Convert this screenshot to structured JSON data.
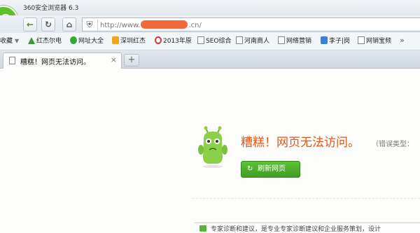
{
  "window": {
    "title": "360安全浏览器 6.3"
  },
  "toolbar": {
    "back_icon": "arrow-left-icon",
    "refresh_icon": "refresh-icon",
    "home_icon": "home-icon",
    "security_icon": "shield-icon",
    "address": {
      "prefix": "http://www.",
      "suffix": ".cn/"
    }
  },
  "bookmarks": {
    "items": [
      {
        "label": "收藏",
        "icon": "none"
      },
      {
        "label": "红杰尔电",
        "icon": "green-triangle-icon"
      },
      {
        "label": "网址大全",
        "icon": "green-circle-icon"
      },
      {
        "label": "深圳红杰",
        "icon": "orange-flag-icon"
      },
      {
        "label": "2013年原",
        "icon": "red-clock-icon"
      },
      {
        "label": "SEO综合",
        "icon": "page-icon"
      },
      {
        "label": "河南商人",
        "icon": "page-icon"
      },
      {
        "label": "网络营销",
        "icon": "page-icon"
      },
      {
        "label": "李子|岗",
        "icon": "blue-s-icon"
      },
      {
        "label": "网销宝频",
        "icon": "page-icon"
      }
    ],
    "more": "»"
  },
  "tabs": [
    {
      "label": "糟糕！网页无法访问。",
      "close": "×",
      "active": true
    }
  ],
  "new_tab": "+",
  "error": {
    "title": "糟糕！网页无法访问。",
    "type_label": "（错误类型：",
    "refresh_button": "刷新网页"
  },
  "bottom": {
    "text": "专家诊断和建议，是专业专家诊断建议和企业服务策划，设计"
  },
  "colors": {
    "brand_green": "#4caf2a",
    "error_orange": "#e2561a",
    "url_redaction": "#f26a3c"
  }
}
